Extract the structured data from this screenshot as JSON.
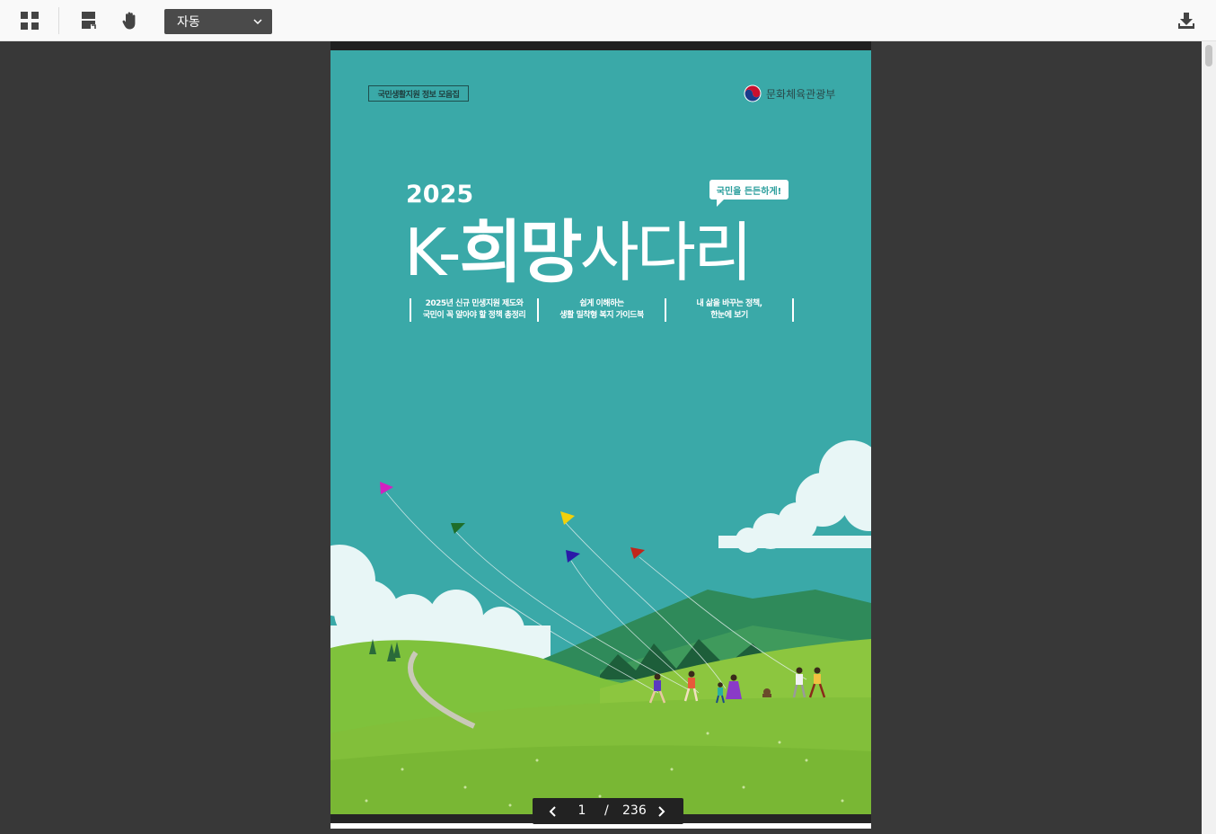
{
  "toolbar": {
    "thumbnails_icon": "grid-icon",
    "scroll_mode_icon": "page-layout-icon",
    "pan_icon": "hand-icon",
    "zoom_value": "자동",
    "download_icon": "download-icon"
  },
  "cover": {
    "tag": "국민생활지원 정보 모음집",
    "ministry": "문화체육관광부",
    "year": "2025",
    "bubble": "국민을 든든하게!",
    "title_prefix": "K-",
    "title_bold": "희망",
    "title_rest": "사다리",
    "subtitles": [
      {
        "line1": "2025년 신규 민생지원 제도와",
        "line2": "국민이 꼭 알아야 할 정책 총정리"
      },
      {
        "line1": "쉽게 이해하는",
        "line2": "생활 밀착형 복지 가이드북"
      },
      {
        "line1": "내 삶을 바꾸는 정책,",
        "line2": "한눈에 보기"
      }
    ],
    "colors": {
      "background": "#3aa9a8",
      "grass": "#8cc63f",
      "mountain": "#2f8a5a"
    }
  },
  "pager": {
    "current": "1",
    "separator": "/",
    "total": "236"
  }
}
